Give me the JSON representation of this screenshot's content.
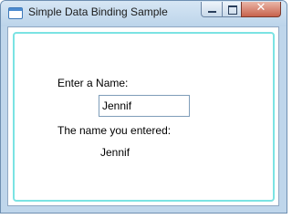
{
  "window": {
    "title": "Simple Data Binding Sample"
  },
  "form": {
    "name_label": "Enter a Name:",
    "name_value": "Jennif",
    "result_label": "The name you entered:",
    "result_value": "Jennif"
  }
}
